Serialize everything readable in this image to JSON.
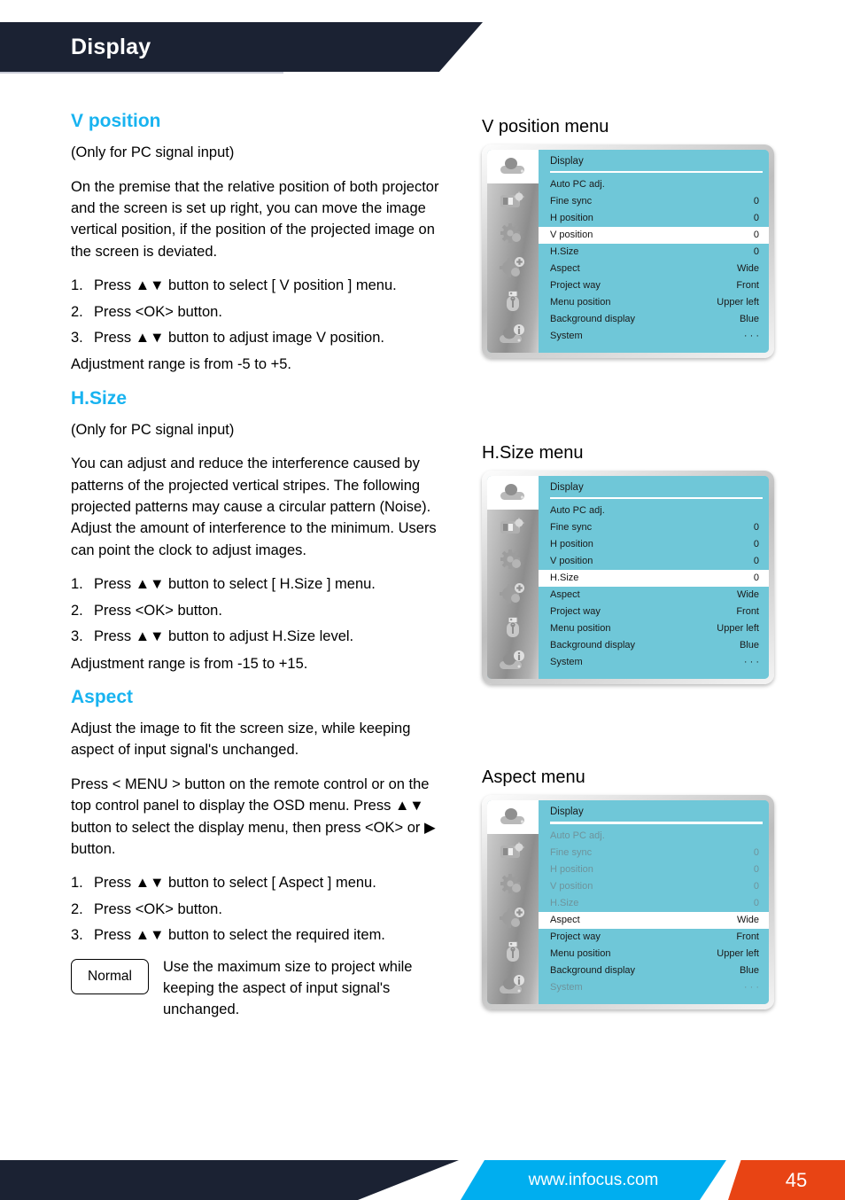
{
  "header": {
    "title": "Display"
  },
  "left_column": {
    "sections": [
      {
        "heading": "V position",
        "note": "(Only for PC signal input)",
        "body": "On the premise that the relative position of both projector and the screen is set up right, you can move the image vertical position, if the position of the projected image on the screen is deviated.",
        "steps": [
          {
            "num": "1.",
            "text": "Press ▲▼ button to select [ V position ] menu."
          },
          {
            "num": "2.",
            "text": "Press <OK> button."
          },
          {
            "num": "3.",
            "text": "Press ▲▼ button to adjust image V position."
          }
        ],
        "range": "Adjustment range is from -5 to +5."
      },
      {
        "heading": "H.Size",
        "note": "(Only for PC signal input)",
        "body": "You can adjust and reduce the interference caused by patterns of the projected vertical stripes. The following projected patterns may cause a circular pattern (Noise). Adjust the amount of interference to the minimum. Users can point the clock to adjust images.",
        "steps": [
          {
            "num": "1.",
            "text": "Press ▲▼ button to select [ H.Size ] menu."
          },
          {
            "num": "2.",
            "text": "Press <OK> button."
          },
          {
            "num": "3.",
            "text": "Press ▲▼ button to adjust H.Size level."
          }
        ],
        "range": "Adjustment range is from -15 to +15."
      },
      {
        "heading": "Aspect",
        "body": "Adjust the image to fit the screen size, while keeping aspect of input signal's unchanged.",
        "body2": "Press < MENU > button on the remote control or on the top control panel to display the OSD menu. Press ▲▼ button to select the display menu, then press <OK> or ▶ button.",
        "steps": [
          {
            "num": "1.",
            "text": "Press ▲▼ button to select [ Aspect ] menu."
          },
          {
            "num": "2.",
            "text": "Press <OK> button."
          },
          {
            "num": "3.",
            "text": "Press ▲▼ button to select the required item."
          }
        ],
        "note_box": {
          "label": "Normal",
          "description": "Use the maximum size to project while keeping the aspect of input signal's unchanged."
        }
      }
    ]
  },
  "osd_menus": [
    {
      "caption": "V position menu",
      "menu_title": "Display",
      "sidebar_icons": [
        "projector-display-icon",
        "image-adjust-icon",
        "gear-setting-icon",
        "gear-expand-setting-icon",
        "usb-memory-icon",
        "projector-info-icon"
      ],
      "active_icon_index": 0,
      "rows": [
        {
          "label": "Auto PC adj.",
          "value": "",
          "state": "normal"
        },
        {
          "label": "Fine sync",
          "value": "0",
          "state": "normal"
        },
        {
          "label": "H position",
          "value": "0",
          "state": "normal"
        },
        {
          "label": "V position",
          "value": "0",
          "state": "highlight"
        },
        {
          "label": "H.Size",
          "value": "0",
          "state": "normal"
        },
        {
          "label": "Aspect",
          "value": "Wide",
          "state": "normal"
        },
        {
          "label": "Project way",
          "value": "Front",
          "state": "normal"
        },
        {
          "label": "Menu position",
          "value": "Upper left",
          "state": "normal"
        },
        {
          "label": "Background display",
          "value": "Blue",
          "state": "normal"
        },
        {
          "label": "System",
          "value": "· · ·",
          "state": "normal"
        }
      ]
    },
    {
      "caption": "H.Size menu",
      "menu_title": "Display",
      "sidebar_icons": [
        "projector-display-icon",
        "image-adjust-icon",
        "gear-setting-icon",
        "gear-expand-setting-icon",
        "usb-memory-icon",
        "projector-info-icon"
      ],
      "active_icon_index": 0,
      "rows": [
        {
          "label": "Auto PC adj.",
          "value": "",
          "state": "normal"
        },
        {
          "label": "Fine sync",
          "value": "0",
          "state": "normal"
        },
        {
          "label": "H position",
          "value": "0",
          "state": "normal"
        },
        {
          "label": "V position",
          "value": "0",
          "state": "normal"
        },
        {
          "label": "H.Size",
          "value": "0",
          "state": "highlight"
        },
        {
          "label": "Aspect",
          "value": "Wide",
          "state": "normal"
        },
        {
          "label": "Project way",
          "value": "Front",
          "state": "normal"
        },
        {
          "label": "Menu position",
          "value": "Upper left",
          "state": "normal"
        },
        {
          "label": "Background display",
          "value": "Blue",
          "state": "normal"
        },
        {
          "label": "System",
          "value": "· · ·",
          "state": "normal"
        }
      ]
    },
    {
      "caption": "Aspect menu",
      "menu_title": "Display",
      "sidebar_icons": [
        "projector-display-icon",
        "image-adjust-icon",
        "gear-setting-icon",
        "gear-expand-setting-icon",
        "usb-memory-icon",
        "projector-info-icon"
      ],
      "active_icon_index": 0,
      "rows": [
        {
          "label": "Auto PC adj.",
          "value": "",
          "state": "dim"
        },
        {
          "label": "Fine sync",
          "value": "0",
          "state": "dim"
        },
        {
          "label": "H position",
          "value": "0",
          "state": "dim"
        },
        {
          "label": "V position",
          "value": "0",
          "state": "dim"
        },
        {
          "label": "H.Size",
          "value": "0",
          "state": "dim"
        },
        {
          "label": "Aspect",
          "value": "Wide",
          "state": "highlight"
        },
        {
          "label": "Project way",
          "value": "Front",
          "state": "normal"
        },
        {
          "label": "Menu position",
          "value": "Upper left",
          "state": "normal"
        },
        {
          "label": "Background display",
          "value": "Blue",
          "state": "normal"
        },
        {
          "label": "System",
          "value": "· · ·",
          "state": "dim"
        }
      ]
    }
  ],
  "footer": {
    "website": "www.infocus.com",
    "page_number": "45"
  },
  "colors": {
    "header_navy": "#1b2233",
    "heading_cyan": "#18b3f0",
    "osd_teal": "#6fc7d8",
    "osd_dim_text": "#6e939b",
    "footer_blue": "#00aeef",
    "footer_orange": "#e84414"
  }
}
